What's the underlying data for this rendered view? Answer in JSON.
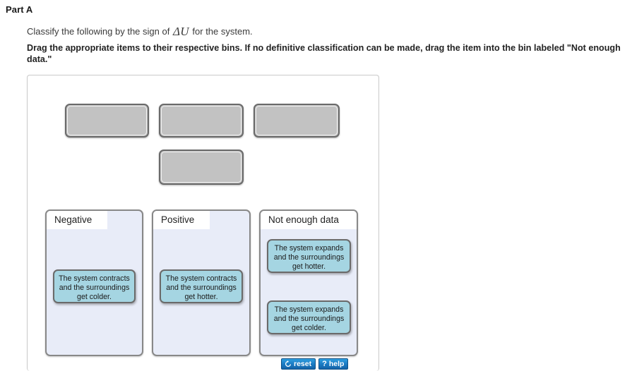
{
  "header": {
    "part_title": "Part A",
    "prompt_line_1_before": "Classify the following by the sign of ",
    "prompt_symbol": "ΔU",
    "prompt_line_1_after": " for the system.",
    "prompt_line_2": "Drag the appropriate items to their respective bins. If no definitive classification can be made, drag the item into the bin labeled \"Not enough data.\""
  },
  "slots": [
    {
      "id": "slot-1",
      "label": ""
    },
    {
      "id": "slot-2",
      "label": ""
    },
    {
      "id": "slot-3",
      "label": ""
    },
    {
      "id": "slot-4",
      "label": ""
    }
  ],
  "bins": [
    {
      "label": "Negative",
      "items": [
        {
          "text": "The system contracts and the surroundings get colder."
        }
      ]
    },
    {
      "label": "Positive",
      "items": [
        {
          "text": "The system contracts and the surroundings get hotter."
        }
      ]
    },
    {
      "label": "Not enough data",
      "items": [
        {
          "text": "The system expands and the surroundings get hotter."
        },
        {
          "text": "The system expands and the surroundings get colder."
        }
      ]
    }
  ],
  "buttons": {
    "reset_label": "reset",
    "reset_icon": "refresh-icon",
    "help_label": "help",
    "help_icon": "question-mark-icon"
  },
  "colors": {
    "item_fill": "#a5d5e2",
    "bin_fill": "#e8ecf8",
    "slot_fill": "#c2c2c2",
    "button_blue": "#1b7cc4"
  }
}
